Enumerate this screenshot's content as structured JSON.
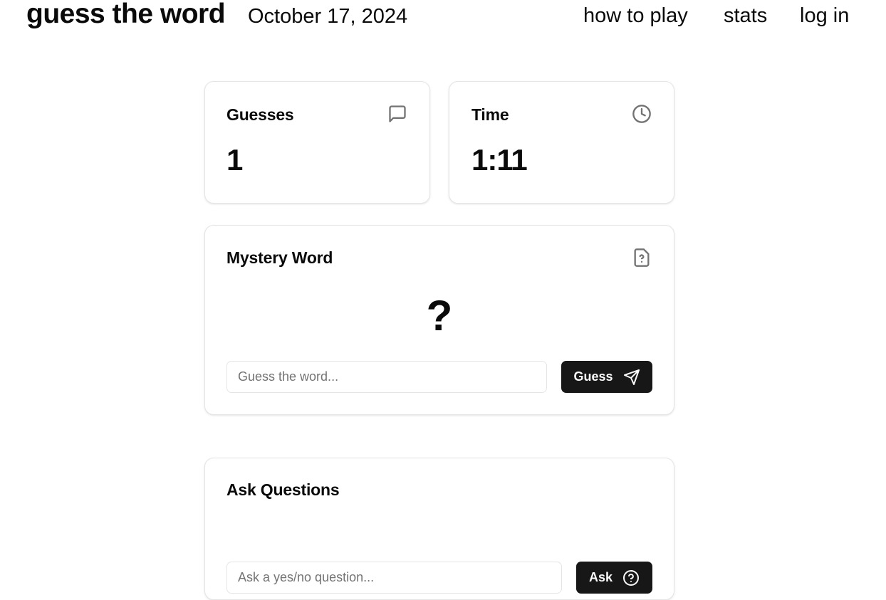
{
  "header": {
    "brand": "guess the word",
    "date": "October 17, 2024",
    "nav": {
      "how_to_play": "how to play",
      "stats": "stats",
      "log_in": "log in"
    }
  },
  "guesses_card": {
    "title": "Guesses",
    "value": "1",
    "icon": "message-square-icon"
  },
  "time_card": {
    "title": "Time",
    "value": "1:11",
    "icon": "clock-icon"
  },
  "mystery_card": {
    "title": "Mystery Word",
    "icon": "file-question-icon",
    "word": "?",
    "input_placeholder": "Guess the word...",
    "input_value": "",
    "button_label": "Guess",
    "button_icon": "send-icon"
  },
  "ask_card": {
    "title": "Ask Questions",
    "input_placeholder": "Ask a yes/no question...",
    "button_label": "Ask",
    "button_icon": "help-circle-icon"
  },
  "colors": {
    "text": "#0a0a0a",
    "button_bg": "#171717",
    "border": "#e5e5e5",
    "icon": "#737373"
  }
}
